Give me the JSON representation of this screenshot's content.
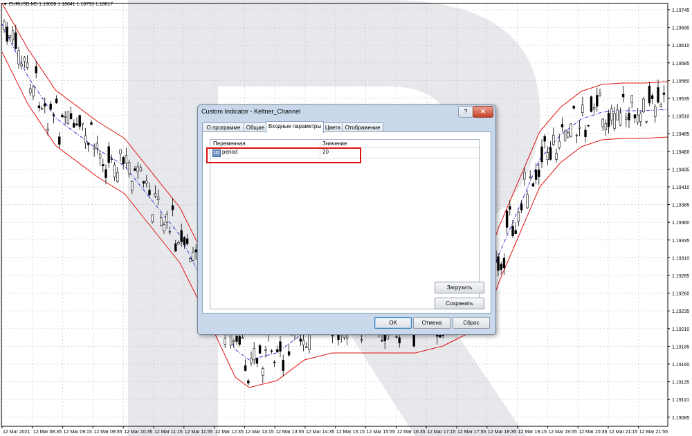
{
  "symbol_label": "EURUSD,M5  1.18838 1.18841 1.18793 1.18817",
  "price_axis": [
    "1.19745",
    "1.19690",
    "1.19610",
    "1.19585",
    "1.19560",
    "1.19535",
    "1.19510",
    "1.19485",
    "1.19460",
    "1.19435",
    "1.19410",
    "1.19385",
    "1.19360",
    "1.19335",
    "1.19310",
    "1.19285",
    "1.19260",
    "1.19235",
    "1.19210",
    "1.19185",
    "1.19160",
    "1.19135",
    "1.19110",
    "1.19085"
  ],
  "time_axis": [
    "12 Mar 2021",
    "12 Mar 08:35",
    "12 Mar 09:15",
    "12 Mar 09:55",
    "12 Mar 10:35",
    "12 Mar 11:15",
    "12 Mar 11:55",
    "12 Mar 12:35",
    "12 Mar 13:15",
    "12 Mar 13:55",
    "12 Mar 14:35",
    "12 Mar 15:15",
    "12 Mar 15:55",
    "12 Mar 16:35",
    "12 Mar 17:15",
    "12 Mar 17:55",
    "12 Mar 18:35",
    "12 Mar 19:15",
    "12 Mar 19:55",
    "12 Mar 20:35",
    "12 Mar 21:15",
    "12 Mar 21:55"
  ],
  "chart_colors": {
    "candle": "#000000",
    "channel": "#e01010",
    "middle": "#2a2ad6",
    "grid": "#c8c8c8",
    "watermark": "#e6e8ec"
  },
  "dialog": {
    "title": "Custom Indicator - Keltner_Channel",
    "help_label": "?",
    "close_label": "✕",
    "tabs": [
      "О программе",
      "Общие",
      "Входные параметры",
      "Цвета",
      "Отображение"
    ],
    "active_tab": "Входные параметры",
    "columns": {
      "variable": "Переменная",
      "value": "Значение"
    },
    "parameters": [
      {
        "icon": "123",
        "name": "period",
        "value": "20"
      }
    ],
    "buttons": {
      "load": "Загрузить",
      "save": "Сохранить",
      "ok": "OK",
      "cancel": "Отмена",
      "reset": "Сброс"
    }
  }
}
